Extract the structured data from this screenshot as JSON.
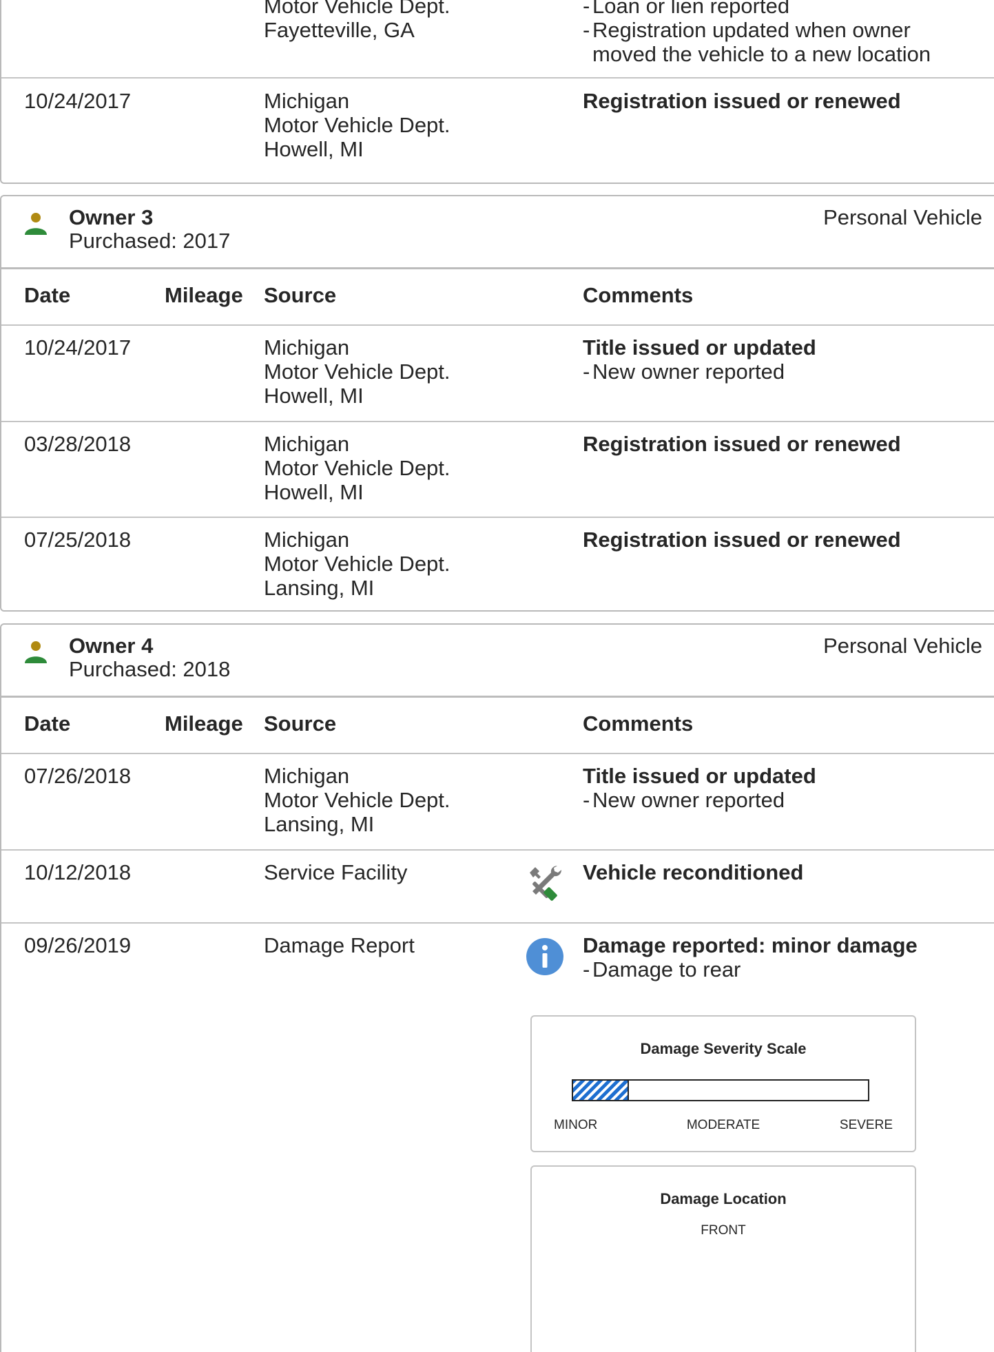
{
  "top_section": {
    "row_a": {
      "source_line2": "Motor Vehicle Dept.",
      "source_line3": "Fayetteville, GA",
      "comment_1": "Loan or lien reported",
      "comment_2a": "Registration updated when owner",
      "comment_2b": "moved the vehicle to a new location"
    },
    "row_b": {
      "date": "10/24/2017",
      "source_line1": "Michigan",
      "source_line2": "Motor Vehicle Dept.",
      "source_line3": "Howell, MI",
      "comment_title": "Registration issued or renewed"
    }
  },
  "table_headers": {
    "date": "Date",
    "mileage": "Mileage",
    "source": "Source",
    "comments": "Comments"
  },
  "owner3": {
    "name": "Owner 3",
    "purchased": "Purchased: 2017",
    "type": "Personal Vehicle",
    "rows": [
      {
        "date": "10/24/2017",
        "source": [
          "Michigan",
          "Motor Vehicle Dept.",
          "Howell, MI"
        ],
        "title": "Title issued or updated",
        "detail": "New owner reported"
      },
      {
        "date": "03/28/2018",
        "source": [
          "Michigan",
          "Motor Vehicle Dept.",
          "Howell, MI"
        ],
        "title": "Registration issued or renewed"
      },
      {
        "date": "07/25/2018",
        "source": [
          "Michigan",
          "Motor Vehicle Dept.",
          "Lansing, MI"
        ],
        "title": "Registration issued or renewed"
      }
    ]
  },
  "owner4": {
    "name": "Owner 4",
    "purchased": "Purchased: 2018",
    "type": "Personal Vehicle",
    "rows": [
      {
        "date": "07/26/2018",
        "source": [
          "Michigan",
          "Motor Vehicle Dept.",
          "Lansing, MI"
        ],
        "title": "Title issued or updated",
        "detail": "New owner reported"
      },
      {
        "date": "10/12/2018",
        "source": [
          "Service Facility"
        ],
        "title": "Vehicle reconditioned",
        "icon": "wrench-screwdriver-icon"
      },
      {
        "date": "09/26/2019",
        "source": [
          "Damage Report"
        ],
        "title": "Damage reported: minor damage",
        "detail": "Damage to rear",
        "icon": "info-icon"
      }
    ],
    "severity": {
      "title": "Damage Severity Scale",
      "level_fraction": 0.19,
      "labels": [
        "MINOR",
        "MODERATE",
        "SEVERE"
      ],
      "fill_color": "#1e6fd0"
    },
    "location": {
      "title": "Damage Location",
      "front_label": "FRONT"
    }
  },
  "colors": {
    "owner_icon_head": "#b08a12",
    "owner_icon_body": "#2e8b3a",
    "info_icon": "#4f8fd6",
    "tool_green": "#2e8b3a",
    "tool_gray": "#7a7a7a"
  }
}
